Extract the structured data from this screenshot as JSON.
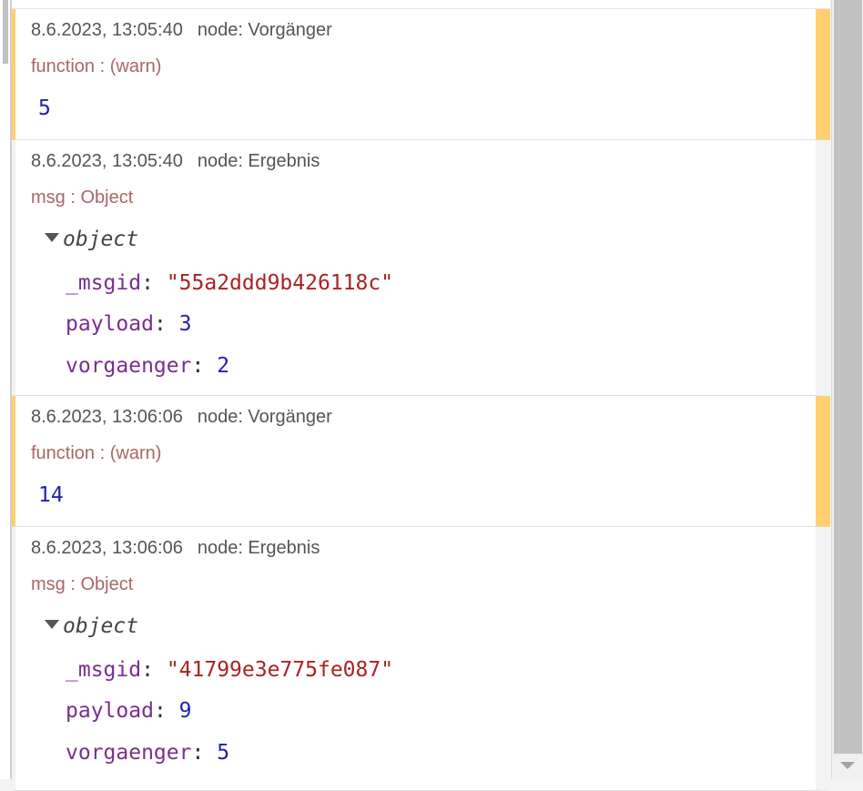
{
  "messages": [
    {
      "timestamp": "8.6.2023, 13:05:40",
      "node": "node: Vorgänger",
      "topic": "function : (warn)",
      "value": "5"
    },
    {
      "timestamp": "8.6.2023, 13:05:40",
      "node": "node: Ergebnis",
      "topic": "msg : Object",
      "type_label": "object",
      "props": [
        {
          "key": "_msgid",
          "value": "\"55a2ddd9b426118c\""
        },
        {
          "key": "payload",
          "value": "3"
        },
        {
          "key": "vorgaenger",
          "value": "2"
        }
      ]
    },
    {
      "timestamp": "8.6.2023, 13:06:06",
      "node": "node: Vorgänger",
      "topic": "function : (warn)",
      "value": "14"
    },
    {
      "timestamp": "8.6.2023, 13:06:06",
      "node": "node: Ergebnis",
      "topic": "msg : Object",
      "type_label": "object",
      "props": [
        {
          "key": "_msgid",
          "value": "\"41799e3e775fe087\""
        },
        {
          "key": "payload",
          "value": "9"
        },
        {
          "key": "vorgaenger",
          "value": "5"
        }
      ]
    }
  ],
  "colors": {
    "warn_accent": "#ffcf70",
    "topic_text": "#aa6666",
    "number": "#2222aa",
    "string": "#aa2222",
    "key": "#792e90"
  },
  "separator": ":"
}
